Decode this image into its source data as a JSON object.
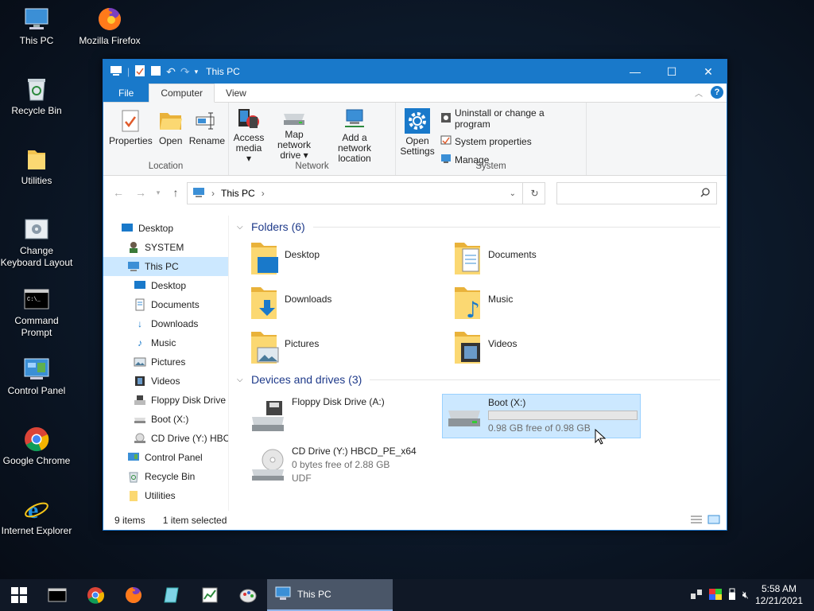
{
  "desktop": {
    "icons": [
      {
        "label": "This PC",
        "icon": "this-pc-icon"
      },
      {
        "label": "Mozilla Firefox",
        "icon": "firefox-icon"
      },
      {
        "label": "Recycle Bin",
        "icon": "recycle-bin-icon"
      },
      {
        "label": "Utilities",
        "icon": "folder-icon"
      },
      {
        "label": "Change Keyboard Layout",
        "icon": "keyboard-layout-icon"
      },
      {
        "label": "Command Prompt",
        "icon": "command-prompt-icon"
      },
      {
        "label": "Control Panel",
        "icon": "control-panel-icon"
      },
      {
        "label": "Google Chrome",
        "icon": "chrome-icon"
      },
      {
        "label": "Internet Explorer",
        "icon": "internet-explorer-icon"
      }
    ]
  },
  "window": {
    "title": "This PC",
    "tabs": {
      "file": "File",
      "computer": "Computer",
      "view": "View"
    },
    "ribbon": {
      "location": {
        "label": "Location",
        "properties": "Properties",
        "open": "Open",
        "rename": "Rename"
      },
      "network": {
        "label": "Network",
        "access_media": "Access media ▾",
        "map_drive": "Map network drive ▾",
        "add_location": "Add a network location"
      },
      "system": {
        "label": "System",
        "open_settings": "Open Settings",
        "uninstall": "Uninstall or change a program",
        "properties": "System properties",
        "manage": "Manage"
      }
    },
    "address": {
      "path": "This PC",
      "search_placeholder": ""
    },
    "nav": [
      {
        "label": "Desktop",
        "level": 0
      },
      {
        "label": "SYSTEM",
        "level": 1
      },
      {
        "label": "This PC",
        "level": 1,
        "selected": true
      },
      {
        "label": "Desktop",
        "level": 2
      },
      {
        "label": "Documents",
        "level": 2
      },
      {
        "label": "Downloads",
        "level": 2
      },
      {
        "label": "Music",
        "level": 2
      },
      {
        "label": "Pictures",
        "level": 2
      },
      {
        "label": "Videos",
        "level": 2
      },
      {
        "label": "Floppy Disk Drive",
        "level": 2
      },
      {
        "label": "Boot (X:)",
        "level": 2
      },
      {
        "label": "CD Drive (Y:) HBC",
        "level": 2
      },
      {
        "label": "Control Panel",
        "level": 1
      },
      {
        "label": "Recycle Bin",
        "level": 1
      },
      {
        "label": "Utilities",
        "level": 1
      }
    ],
    "folders_header": "Folders (6)",
    "folders": [
      "Desktop",
      "Documents",
      "Downloads",
      "Music",
      "Pictures",
      "Videos"
    ],
    "devices_header": "Devices and drives (3)",
    "drives": {
      "floppy": {
        "name": "Floppy Disk Drive (A:)"
      },
      "boot": {
        "name": "Boot (X:)",
        "free": "0.98 GB free of 0.98 GB",
        "used_fraction": 0.0
      },
      "cd": {
        "name": "CD Drive (Y:) HBCD_PE_x64",
        "free": "0 bytes free of 2.88 GB",
        "fs": "UDF"
      }
    },
    "status": {
      "items": "9 items",
      "selected": "1 item selected"
    }
  },
  "taskbar": {
    "active_window": "This PC",
    "time": "5:58 AM",
    "date": "12/21/2021"
  },
  "colors": {
    "accent": "#1979ca",
    "selection": "#cce8ff"
  }
}
